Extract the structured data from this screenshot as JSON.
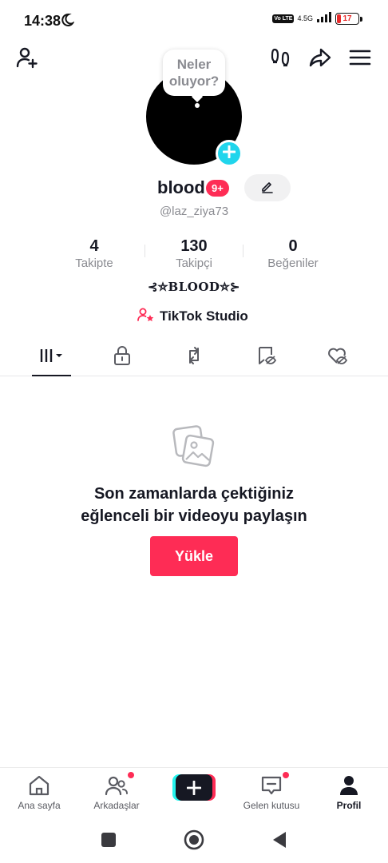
{
  "status_bar": {
    "time": "14:38",
    "volte": "Vo LTE",
    "network": "4.5G",
    "battery": "17",
    "battery_color": "#e82a2a"
  },
  "top_bar": {
    "icons": [
      "add-friend-icon",
      "footprints-icon",
      "share-icon",
      "menu-icon"
    ]
  },
  "profile": {
    "note_text": "Neler oluyor?",
    "username": "blood",
    "notification_badge": "9+",
    "handle": "@laz_ziya73",
    "stats": [
      {
        "value": "4",
        "label": "Takipte"
      },
      {
        "value": "130",
        "label": "Takipçi"
      },
      {
        "value": "0",
        "label": "Beğeniler"
      }
    ],
    "bio": "⊰⛤BLOOD⛤⊱",
    "studio_label": "TikTok Studio"
  },
  "tabs": [
    "videos-grid-icon",
    "lock-icon",
    "repost-icon",
    "saved-icon",
    "liked-icon"
  ],
  "empty_state": {
    "title_line1": "Son zamanlarda çektiğiniz",
    "title_line2": "eğlenceli bir videoyu paylaşın",
    "button_label": "Yükle"
  },
  "bottom_nav": {
    "home_label": "Ana sayfa",
    "friends_label": "Arkadaşlar",
    "inbox_label": "Gelen kutusu",
    "profile_label": "Profil"
  },
  "colors": {
    "accent": "#fe2c55",
    "cyan": "#25f4ee",
    "avatar_add": "#20d5ec",
    "text_primary": "#161823",
    "text_secondary": "#8a8b91"
  }
}
